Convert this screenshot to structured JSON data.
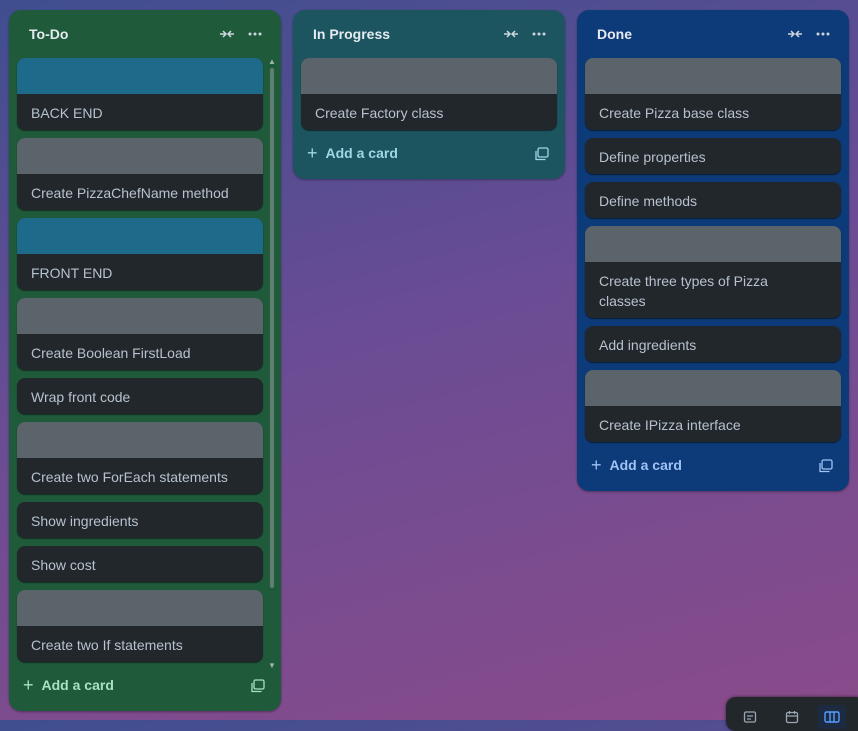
{
  "colors": {
    "todo_list": "#1f5a3a",
    "inprogress_list": "#1c5560",
    "done_list": "#0d3a78",
    "card": "#22272b",
    "cover_teal": "#1d6a8a",
    "cover_gray": "#5b646b"
  },
  "lists": {
    "todo": {
      "title": "To-Do",
      "add_label": "Add a card",
      "cards": [
        {
          "text": "BACK END",
          "cover": "teal"
        },
        {
          "text": "Create PizzaChefName method",
          "cover": "gray"
        },
        {
          "text": "FRONT END",
          "cover": "teal"
        },
        {
          "text": "Create Boolean FirstLoad",
          "cover": "gray"
        },
        {
          "text": "Wrap front code",
          "cover": "none"
        },
        {
          "text": "Create two ForEach statements",
          "cover": "gray"
        },
        {
          "text": "Show ingredients",
          "cover": "none"
        },
        {
          "text": "Show cost",
          "cover": "none"
        },
        {
          "text": "Create two If statements",
          "cover": "gray"
        }
      ]
    },
    "inprogress": {
      "title": "In Progress",
      "add_label": "Add a card",
      "cards": [
        {
          "text": "Create Factory class",
          "cover": "gray"
        }
      ]
    },
    "done": {
      "title": "Done",
      "add_label": "Add a card",
      "cards": [
        {
          "text": "Create Pizza base class",
          "cover": "gray"
        },
        {
          "text": "Define properties",
          "cover": "none"
        },
        {
          "text": "Define methods",
          "cover": "none"
        },
        {
          "text": "Create three types of Pizza classes",
          "cover": "gray"
        },
        {
          "text": "Add ingredients",
          "cover": "none"
        },
        {
          "text": "Create IPizza interface",
          "cover": "gray"
        }
      ]
    }
  },
  "icons": {
    "collapse": "collapse-arrows-icon",
    "menu": "more-horizontal-icon",
    "plus": "plus-icon",
    "template": "card-template-icon",
    "inbox": "inbox-icon",
    "planner": "calendar-icon",
    "board": "board-icon"
  }
}
